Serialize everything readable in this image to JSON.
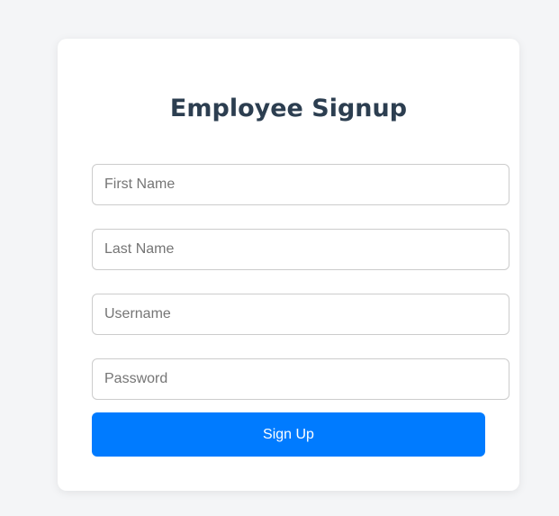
{
  "form": {
    "title": "Employee Signup",
    "fields": [
      {
        "placeholder": "First Name",
        "value": ""
      },
      {
        "placeholder": "Last Name",
        "value": ""
      },
      {
        "placeholder": "Username",
        "value": ""
      },
      {
        "placeholder": "Password",
        "value": ""
      }
    ],
    "submit_label": "Sign Up"
  },
  "colors": {
    "accent": "#007bff",
    "title": "#2c3e50",
    "background": "#f4f5f7"
  }
}
